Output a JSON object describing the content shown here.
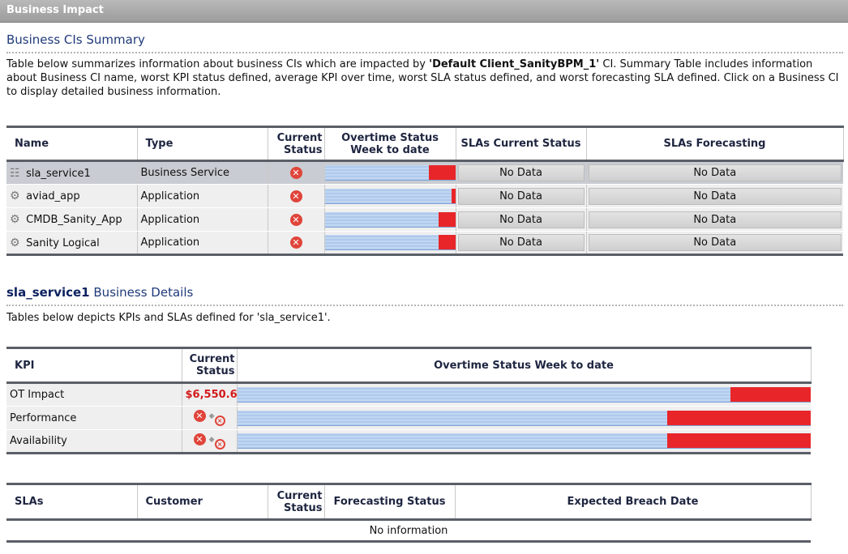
{
  "panel_title": "Business Impact",
  "summary": {
    "title": "Business CIs Summary",
    "description_pre": "Table below summarizes information about business CIs which are impacted by ",
    "description_ci": "'Default Client_SanityBPM_1'",
    "description_post": " CI. Summary Table includes information about Business CI name, worst KPI status defined, average KPI over time, worst SLA status defined, and worst forecasting SLA defined. Click on a Business CI to display detailed business information.",
    "headers": {
      "name": "Name",
      "type": "Type",
      "current_status": "Current Status",
      "overtime": "Overtime Status Week to date",
      "sla_current": "SLAs Current Status",
      "sla_forecast": "SLAs Forecasting"
    },
    "rows": [
      {
        "name": "sla_service1",
        "type": "Business Service",
        "status": "error",
        "red_fraction": 0.2,
        "sla_current": "No Data",
        "sla_forecast": "No Data",
        "icon": "business-service-icon"
      },
      {
        "name": "aviad_app",
        "type": "Application",
        "status": "error",
        "red_fraction": 0.03,
        "sla_current": "No Data",
        "sla_forecast": "No Data",
        "icon": "application-gear-icon"
      },
      {
        "name": "CMDB_Sanity_App",
        "type": "Application",
        "status": "error",
        "red_fraction": 0.13,
        "sla_current": "No Data",
        "sla_forecast": "No Data",
        "icon": "application-gear-icon"
      },
      {
        "name": "Sanity Logical",
        "type": "Application",
        "status": "error",
        "red_fraction": 0.13,
        "sla_current": "No Data",
        "sla_forecast": "No Data",
        "icon": "application-gear-icon"
      }
    ]
  },
  "details": {
    "ci_name": "sla_service1",
    "title_suffix": " Business Details",
    "description": "Tables below depicts KPIs and SLAs defined for 'sla_service1'.",
    "kpi_headers": {
      "kpi": "KPI",
      "current_status": "Current Status",
      "overtime": "Overtime Status Week to date"
    },
    "kpis": [
      {
        "name": "OT Impact",
        "value": "$6,550.6",
        "red_fraction": 0.14
      },
      {
        "name": "Performance",
        "value": "",
        "red_fraction": 0.25
      },
      {
        "name": "Availability",
        "value": "",
        "red_fraction": 0.25
      }
    ],
    "sla_headers": {
      "slas": "SLAs",
      "customer": "Customer",
      "current_status": "Current Status",
      "forecasting": "Forecasting Status",
      "breach": "Expected Breach Date"
    },
    "sla_empty": "No information"
  },
  "colors": {
    "status_error": "#e0443a",
    "bar_red": "#e8262a",
    "bar_blue": "#a7c3e9",
    "header_rule": "#5a5f67"
  }
}
